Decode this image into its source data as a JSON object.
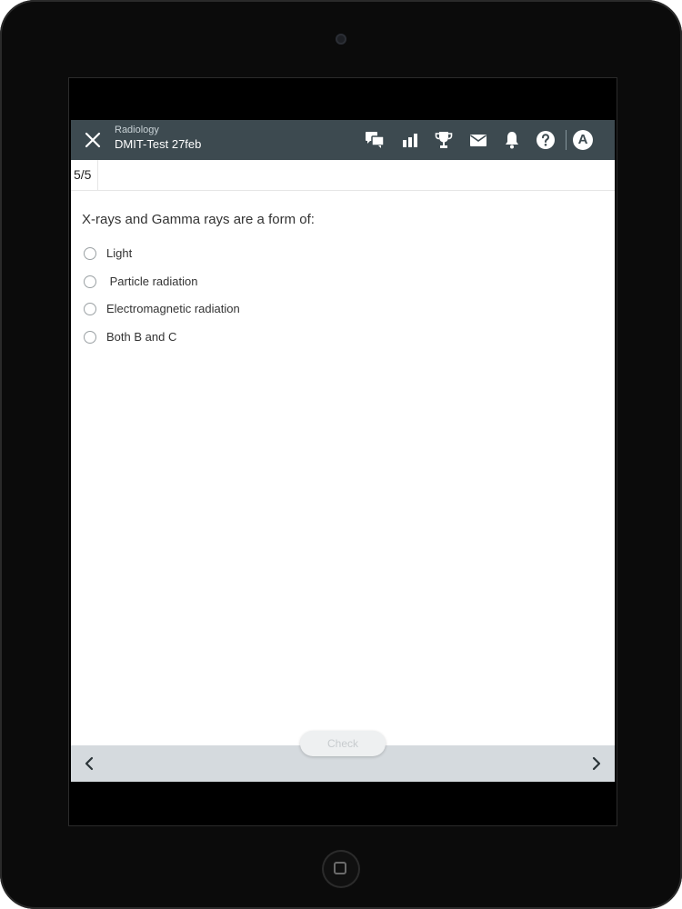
{
  "header": {
    "subtitle": "Radiology",
    "title": "DMIT-Test 27feb",
    "avatar_letter": "A",
    "icons": [
      "close-icon",
      "chat-icon",
      "stats-icon",
      "trophy-icon",
      "mail-icon",
      "bell-icon",
      "help-icon",
      "avatar"
    ]
  },
  "progress": {
    "label": "5/5"
  },
  "question": {
    "text": "X-rays and Gamma rays are a form of:",
    "options": [
      {
        "label": "Light"
      },
      {
        "label": " Particle radiation"
      },
      {
        "label": "Electromagnetic radiation"
      },
      {
        "label": "Both B and C"
      }
    ]
  },
  "footer": {
    "check_label": "Check",
    "icons": [
      "chevron-left-icon",
      "chevron-right-icon"
    ]
  },
  "colors": {
    "header_bg": "#3d4a50",
    "footer_bg": "#d5dade",
    "device_frame": "#0b0b0b"
  }
}
